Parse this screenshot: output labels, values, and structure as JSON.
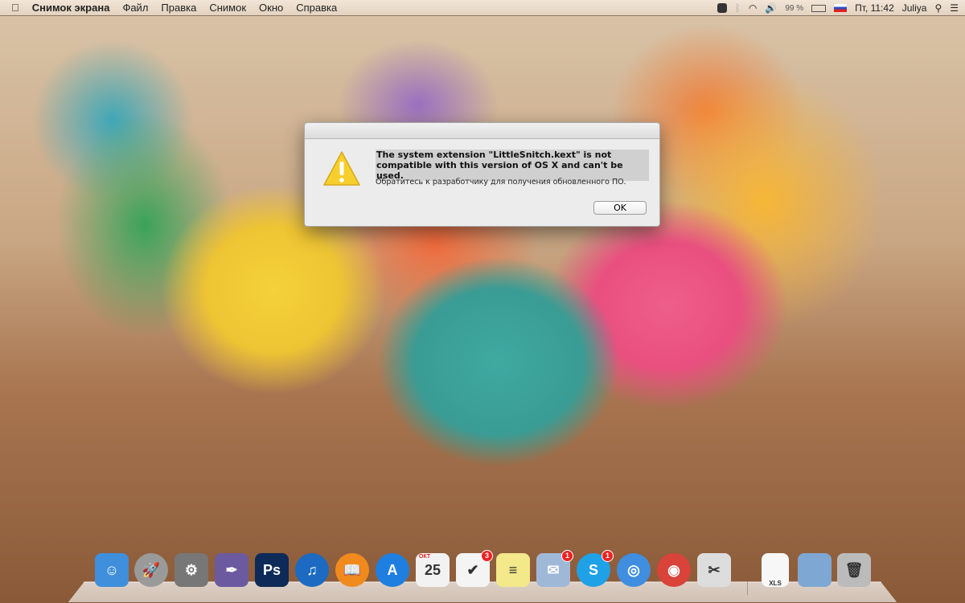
{
  "menubar": {
    "app_name": "Снимок экрана",
    "items": [
      "Файл",
      "Правка",
      "Снимок",
      "Окно",
      "Справка"
    ],
    "battery": "99 %",
    "clock": "Пт, 11:42",
    "user": "Juliya"
  },
  "dialog": {
    "message": "The system extension \"LittleSnitch.kext\" is not compatible with this version of OS X and can't be used.",
    "informative": "Обратитесь к разработчику для получения обновленного ПО.",
    "ok_label": "OK"
  },
  "dock": {
    "items": [
      {
        "name": "finder",
        "glyph": "☺",
        "color": "#3f8fdc"
      },
      {
        "name": "launchpad",
        "glyph": "🚀",
        "color": "#9a9a9a"
      },
      {
        "name": "system-preferences",
        "glyph": "⚙",
        "color": "#777"
      },
      {
        "name": "script-editor",
        "glyph": "✒",
        "color": "#6c5aa0"
      },
      {
        "name": "photoshop",
        "glyph": "Ps",
        "color": "#0d2a58"
      },
      {
        "name": "itunes",
        "glyph": "♫",
        "color": "#1c6ac2"
      },
      {
        "name": "ibooks",
        "glyph": "📖",
        "color": "#f08a1c"
      },
      {
        "name": "app-store",
        "glyph": "A",
        "color": "#1f7fe0"
      },
      {
        "name": "calendar",
        "glyph": "25",
        "color": "#f2f2f2",
        "sub": "ОКТ"
      },
      {
        "name": "reminders",
        "glyph": "✔",
        "color": "#f4f4f4",
        "badge": "3"
      },
      {
        "name": "stickies",
        "glyph": "≡",
        "color": "#f3e88a"
      },
      {
        "name": "mail",
        "glyph": "✉",
        "color": "#9fb8d8",
        "badge": "1"
      },
      {
        "name": "skype",
        "glyph": "S",
        "color": "#1ea1e6",
        "badge": "1"
      },
      {
        "name": "safari",
        "glyph": "◎",
        "color": "#3f8ee0"
      },
      {
        "name": "chrome",
        "glyph": "◉",
        "color": "#d9433a"
      },
      {
        "name": "grab",
        "glyph": "✂",
        "color": "#ddd"
      },
      {
        "name": "xls-file",
        "glyph": "XLS",
        "color": "#f7f7f7"
      },
      {
        "name": "downloads-folder",
        "glyph": "",
        "color": "#7ea8d3"
      },
      {
        "name": "trash",
        "glyph": "🗑",
        "color": "#bbb"
      }
    ]
  },
  "colors": {
    "dialog_bg": "#ececec",
    "badge": "#e22"
  }
}
